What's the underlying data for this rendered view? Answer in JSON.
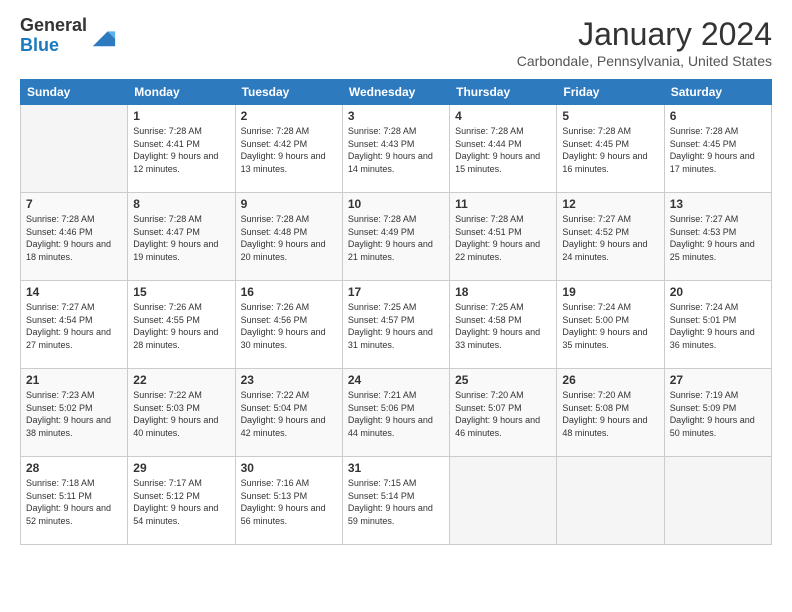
{
  "logo": {
    "general": "General",
    "blue": "Blue"
  },
  "header": {
    "month": "January 2024",
    "location": "Carbondale, Pennsylvania, United States"
  },
  "weekdays": [
    "Sunday",
    "Monday",
    "Tuesday",
    "Wednesday",
    "Thursday",
    "Friday",
    "Saturday"
  ],
  "weeks": [
    [
      {
        "day": "",
        "empty": true
      },
      {
        "day": "1",
        "sunrise": "Sunrise: 7:28 AM",
        "sunset": "Sunset: 4:41 PM",
        "daylight": "Daylight: 9 hours and 12 minutes."
      },
      {
        "day": "2",
        "sunrise": "Sunrise: 7:28 AM",
        "sunset": "Sunset: 4:42 PM",
        "daylight": "Daylight: 9 hours and 13 minutes."
      },
      {
        "day": "3",
        "sunrise": "Sunrise: 7:28 AM",
        "sunset": "Sunset: 4:43 PM",
        "daylight": "Daylight: 9 hours and 14 minutes."
      },
      {
        "day": "4",
        "sunrise": "Sunrise: 7:28 AM",
        "sunset": "Sunset: 4:44 PM",
        "daylight": "Daylight: 9 hours and 15 minutes."
      },
      {
        "day": "5",
        "sunrise": "Sunrise: 7:28 AM",
        "sunset": "Sunset: 4:45 PM",
        "daylight": "Daylight: 9 hours and 16 minutes."
      },
      {
        "day": "6",
        "sunrise": "Sunrise: 7:28 AM",
        "sunset": "Sunset: 4:45 PM",
        "daylight": "Daylight: 9 hours and 17 minutes."
      }
    ],
    [
      {
        "day": "7",
        "sunrise": "Sunrise: 7:28 AM",
        "sunset": "Sunset: 4:46 PM",
        "daylight": "Daylight: 9 hours and 18 minutes."
      },
      {
        "day": "8",
        "sunrise": "Sunrise: 7:28 AM",
        "sunset": "Sunset: 4:47 PM",
        "daylight": "Daylight: 9 hours and 19 minutes."
      },
      {
        "day": "9",
        "sunrise": "Sunrise: 7:28 AM",
        "sunset": "Sunset: 4:48 PM",
        "daylight": "Daylight: 9 hours and 20 minutes."
      },
      {
        "day": "10",
        "sunrise": "Sunrise: 7:28 AM",
        "sunset": "Sunset: 4:49 PM",
        "daylight": "Daylight: 9 hours and 21 minutes."
      },
      {
        "day": "11",
        "sunrise": "Sunrise: 7:28 AM",
        "sunset": "Sunset: 4:51 PM",
        "daylight": "Daylight: 9 hours and 22 minutes."
      },
      {
        "day": "12",
        "sunrise": "Sunrise: 7:27 AM",
        "sunset": "Sunset: 4:52 PM",
        "daylight": "Daylight: 9 hours and 24 minutes."
      },
      {
        "day": "13",
        "sunrise": "Sunrise: 7:27 AM",
        "sunset": "Sunset: 4:53 PM",
        "daylight": "Daylight: 9 hours and 25 minutes."
      }
    ],
    [
      {
        "day": "14",
        "sunrise": "Sunrise: 7:27 AM",
        "sunset": "Sunset: 4:54 PM",
        "daylight": "Daylight: 9 hours and 27 minutes."
      },
      {
        "day": "15",
        "sunrise": "Sunrise: 7:26 AM",
        "sunset": "Sunset: 4:55 PM",
        "daylight": "Daylight: 9 hours and 28 minutes."
      },
      {
        "day": "16",
        "sunrise": "Sunrise: 7:26 AM",
        "sunset": "Sunset: 4:56 PM",
        "daylight": "Daylight: 9 hours and 30 minutes."
      },
      {
        "day": "17",
        "sunrise": "Sunrise: 7:25 AM",
        "sunset": "Sunset: 4:57 PM",
        "daylight": "Daylight: 9 hours and 31 minutes."
      },
      {
        "day": "18",
        "sunrise": "Sunrise: 7:25 AM",
        "sunset": "Sunset: 4:58 PM",
        "daylight": "Daylight: 9 hours and 33 minutes."
      },
      {
        "day": "19",
        "sunrise": "Sunrise: 7:24 AM",
        "sunset": "Sunset: 5:00 PM",
        "daylight": "Daylight: 9 hours and 35 minutes."
      },
      {
        "day": "20",
        "sunrise": "Sunrise: 7:24 AM",
        "sunset": "Sunset: 5:01 PM",
        "daylight": "Daylight: 9 hours and 36 minutes."
      }
    ],
    [
      {
        "day": "21",
        "sunrise": "Sunrise: 7:23 AM",
        "sunset": "Sunset: 5:02 PM",
        "daylight": "Daylight: 9 hours and 38 minutes."
      },
      {
        "day": "22",
        "sunrise": "Sunrise: 7:22 AM",
        "sunset": "Sunset: 5:03 PM",
        "daylight": "Daylight: 9 hours and 40 minutes."
      },
      {
        "day": "23",
        "sunrise": "Sunrise: 7:22 AM",
        "sunset": "Sunset: 5:04 PM",
        "daylight": "Daylight: 9 hours and 42 minutes."
      },
      {
        "day": "24",
        "sunrise": "Sunrise: 7:21 AM",
        "sunset": "Sunset: 5:06 PM",
        "daylight": "Daylight: 9 hours and 44 minutes."
      },
      {
        "day": "25",
        "sunrise": "Sunrise: 7:20 AM",
        "sunset": "Sunset: 5:07 PM",
        "daylight": "Daylight: 9 hours and 46 minutes."
      },
      {
        "day": "26",
        "sunrise": "Sunrise: 7:20 AM",
        "sunset": "Sunset: 5:08 PM",
        "daylight": "Daylight: 9 hours and 48 minutes."
      },
      {
        "day": "27",
        "sunrise": "Sunrise: 7:19 AM",
        "sunset": "Sunset: 5:09 PM",
        "daylight": "Daylight: 9 hours and 50 minutes."
      }
    ],
    [
      {
        "day": "28",
        "sunrise": "Sunrise: 7:18 AM",
        "sunset": "Sunset: 5:11 PM",
        "daylight": "Daylight: 9 hours and 52 minutes."
      },
      {
        "day": "29",
        "sunrise": "Sunrise: 7:17 AM",
        "sunset": "Sunset: 5:12 PM",
        "daylight": "Daylight: 9 hours and 54 minutes."
      },
      {
        "day": "30",
        "sunrise": "Sunrise: 7:16 AM",
        "sunset": "Sunset: 5:13 PM",
        "daylight": "Daylight: 9 hours and 56 minutes."
      },
      {
        "day": "31",
        "sunrise": "Sunrise: 7:15 AM",
        "sunset": "Sunset: 5:14 PM",
        "daylight": "Daylight: 9 hours and 59 minutes."
      },
      {
        "day": "",
        "empty": true
      },
      {
        "day": "",
        "empty": true
      },
      {
        "day": "",
        "empty": true
      }
    ]
  ]
}
